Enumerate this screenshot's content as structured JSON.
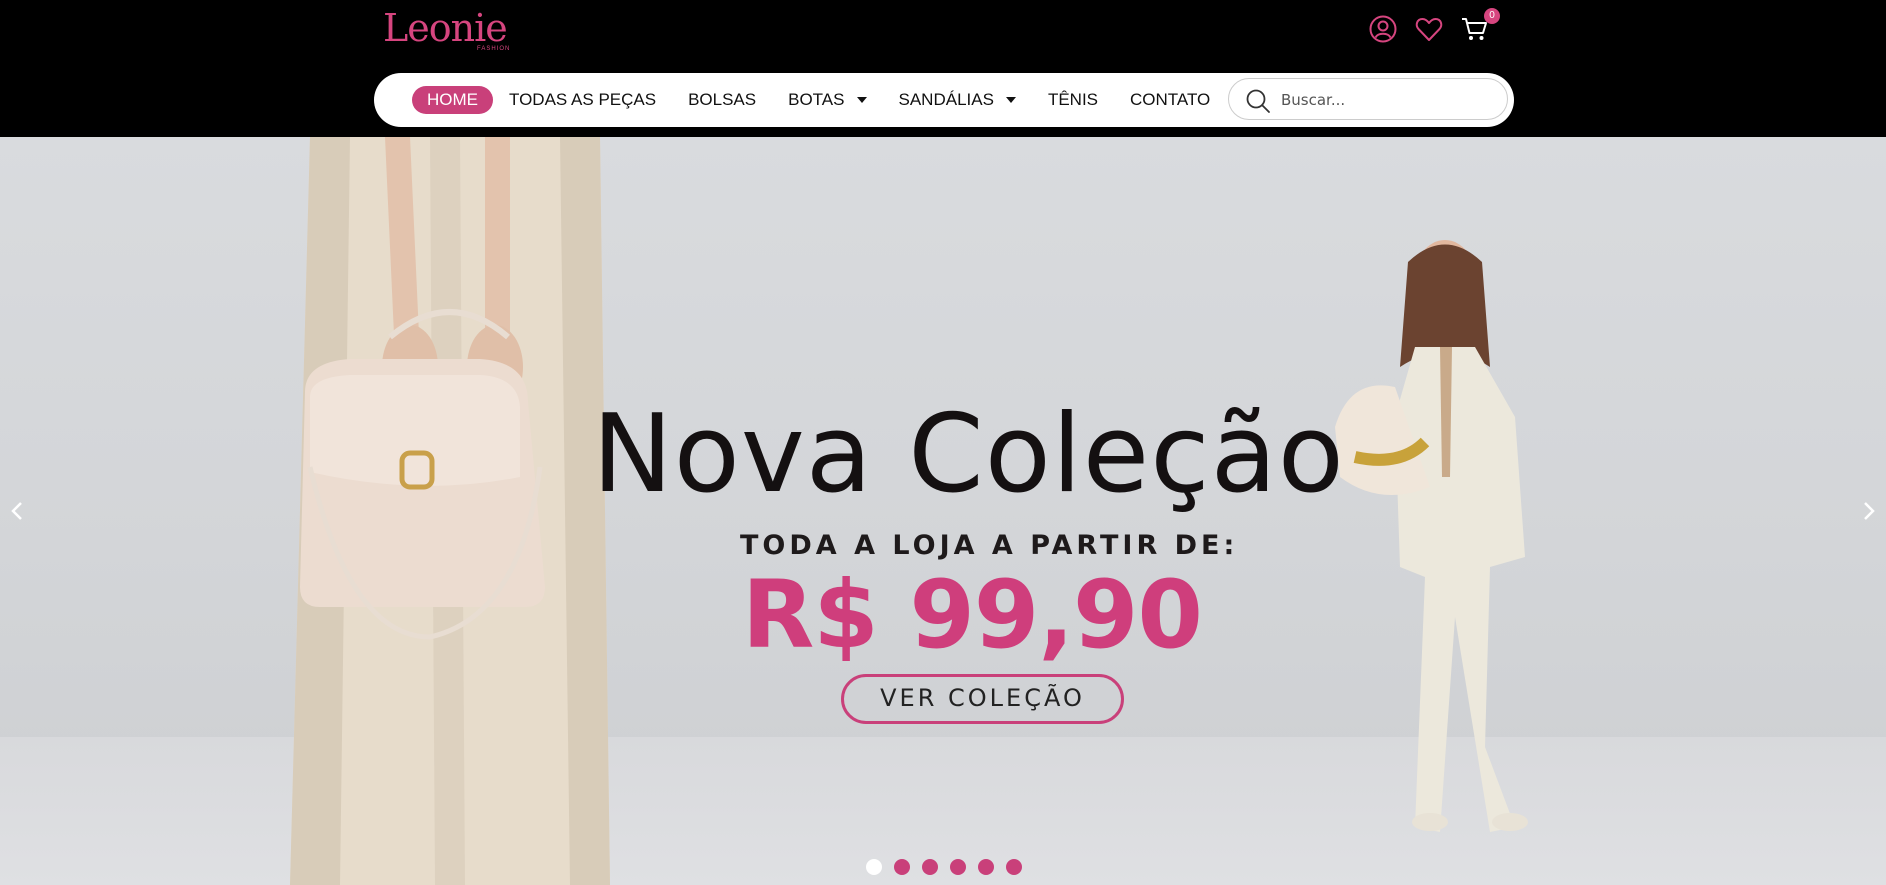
{
  "brand": {
    "name": "Leonie",
    "sub": "FASHION",
    "color": "#d6457f"
  },
  "header": {
    "icons": [
      "user-icon",
      "heart-icon",
      "cart-icon"
    ],
    "cart_count": "0"
  },
  "nav": {
    "items": [
      {
        "label": "HOME",
        "active": true
      },
      {
        "label": "TODAS AS PEÇAS"
      },
      {
        "label": "BOLSAS"
      },
      {
        "label": "BOTAS",
        "dropdown": true
      },
      {
        "label": "SANDÁLIAS",
        "dropdown": true
      },
      {
        "label": "TÊNIS"
      },
      {
        "label": "CONTATO"
      }
    ]
  },
  "search": {
    "placeholder": "Buscar...",
    "value": ""
  },
  "hero": {
    "headline": "Nova Coleção",
    "subline": "TODA A  LOJA A PARTIR DE:",
    "price": "R$ 99,90",
    "cta": "VER COLEÇÃO",
    "slides": 6,
    "active_slide": 1
  },
  "colors": {
    "accent": "#c9407a",
    "topbar": "#000000"
  }
}
